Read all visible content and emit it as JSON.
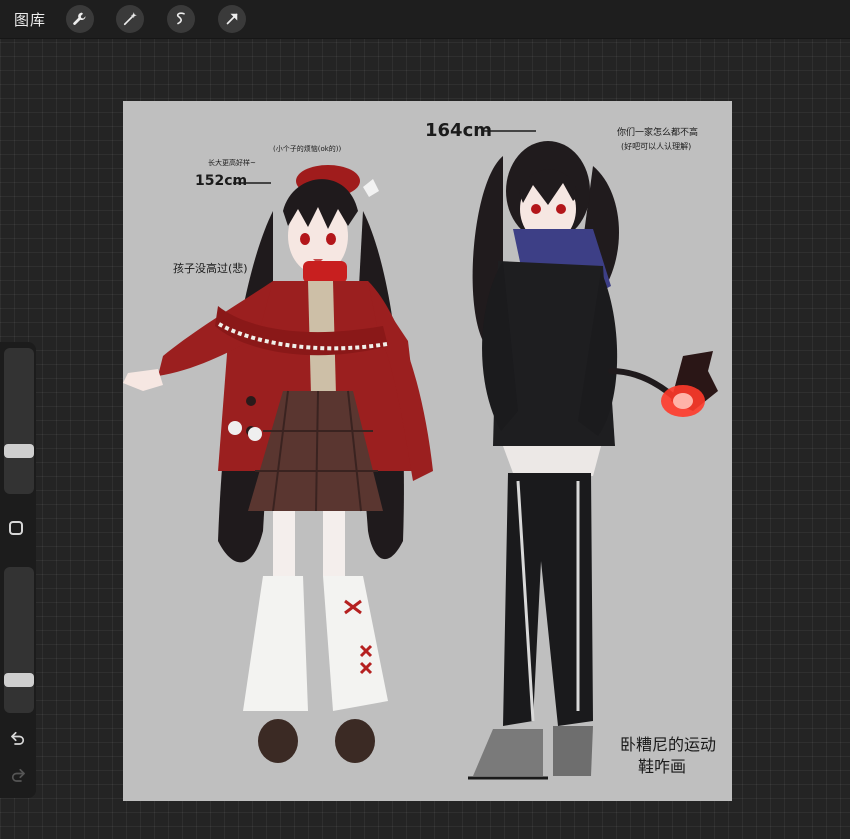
{
  "topbar": {
    "gallery_label": "图库",
    "tools": [
      {
        "icon": "wrench-icon",
        "label": "Actions"
      },
      {
        "icon": "magic-wand-icon",
        "label": "Adjustments"
      },
      {
        "icon": "selection-icon",
        "label": "Selection"
      },
      {
        "icon": "transform-arrow-icon",
        "label": "Transform"
      }
    ]
  },
  "sidebar": {
    "brush_size_level": 0.27,
    "opacity_level": 0.2,
    "icons": [
      "modify-square-icon",
      "undo-icon",
      "redo-icon"
    ]
  },
  "artwork": {
    "height_left": "152cm",
    "height_right": "164cm",
    "note_left_top": "(小个子的烦恼(ok的))",
    "note_left_mid": "长大更高好样~",
    "note_left_label": "孩子没高过(悲)",
    "note_right_top": "你们一家怎么都不高",
    "note_right_sub": "(好吧可以人认理解)",
    "signature_line1": "卧糟尼的运动",
    "signature_line2": "鞋咋画"
  },
  "colors": {
    "canvas_bg": "#bfbfbf",
    "app_bg": "#242424",
    "topbar_bg": "#1e1e1e",
    "red_coat": "#9b1f1f",
    "blue_scarf": "#3d3f86",
    "flame": "#ff3a2a"
  }
}
